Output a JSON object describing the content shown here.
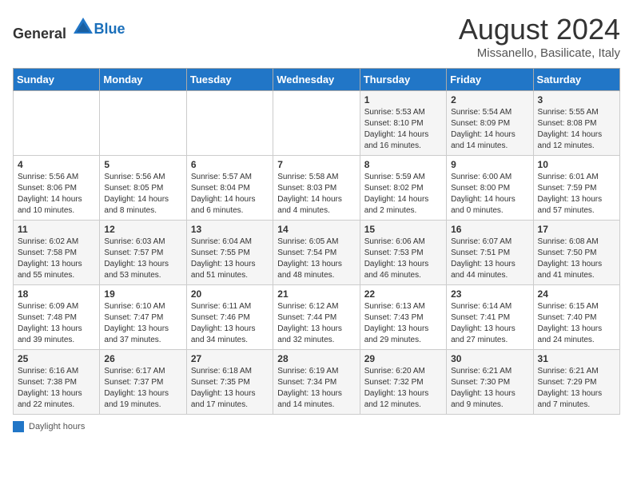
{
  "header": {
    "logo_general": "General",
    "logo_blue": "Blue",
    "title": "August 2024",
    "subtitle": "Missanello, Basilicate, Italy"
  },
  "days_of_week": [
    "Sunday",
    "Monday",
    "Tuesday",
    "Wednesday",
    "Thursday",
    "Friday",
    "Saturday"
  ],
  "weeks": [
    [
      {
        "day": "",
        "info": ""
      },
      {
        "day": "",
        "info": ""
      },
      {
        "day": "",
        "info": ""
      },
      {
        "day": "",
        "info": ""
      },
      {
        "day": "1",
        "info": "Sunrise: 5:53 AM\nSunset: 8:10 PM\nDaylight: 14 hours and 16 minutes."
      },
      {
        "day": "2",
        "info": "Sunrise: 5:54 AM\nSunset: 8:09 PM\nDaylight: 14 hours and 14 minutes."
      },
      {
        "day": "3",
        "info": "Sunrise: 5:55 AM\nSunset: 8:08 PM\nDaylight: 14 hours and 12 minutes."
      }
    ],
    [
      {
        "day": "4",
        "info": "Sunrise: 5:56 AM\nSunset: 8:06 PM\nDaylight: 14 hours and 10 minutes."
      },
      {
        "day": "5",
        "info": "Sunrise: 5:56 AM\nSunset: 8:05 PM\nDaylight: 14 hours and 8 minutes."
      },
      {
        "day": "6",
        "info": "Sunrise: 5:57 AM\nSunset: 8:04 PM\nDaylight: 14 hours and 6 minutes."
      },
      {
        "day": "7",
        "info": "Sunrise: 5:58 AM\nSunset: 8:03 PM\nDaylight: 14 hours and 4 minutes."
      },
      {
        "day": "8",
        "info": "Sunrise: 5:59 AM\nSunset: 8:02 PM\nDaylight: 14 hours and 2 minutes."
      },
      {
        "day": "9",
        "info": "Sunrise: 6:00 AM\nSunset: 8:00 PM\nDaylight: 14 hours and 0 minutes."
      },
      {
        "day": "10",
        "info": "Sunrise: 6:01 AM\nSunset: 7:59 PM\nDaylight: 13 hours and 57 minutes."
      }
    ],
    [
      {
        "day": "11",
        "info": "Sunrise: 6:02 AM\nSunset: 7:58 PM\nDaylight: 13 hours and 55 minutes."
      },
      {
        "day": "12",
        "info": "Sunrise: 6:03 AM\nSunset: 7:57 PM\nDaylight: 13 hours and 53 minutes."
      },
      {
        "day": "13",
        "info": "Sunrise: 6:04 AM\nSunset: 7:55 PM\nDaylight: 13 hours and 51 minutes."
      },
      {
        "day": "14",
        "info": "Sunrise: 6:05 AM\nSunset: 7:54 PM\nDaylight: 13 hours and 48 minutes."
      },
      {
        "day": "15",
        "info": "Sunrise: 6:06 AM\nSunset: 7:53 PM\nDaylight: 13 hours and 46 minutes."
      },
      {
        "day": "16",
        "info": "Sunrise: 6:07 AM\nSunset: 7:51 PM\nDaylight: 13 hours and 44 minutes."
      },
      {
        "day": "17",
        "info": "Sunrise: 6:08 AM\nSunset: 7:50 PM\nDaylight: 13 hours and 41 minutes."
      }
    ],
    [
      {
        "day": "18",
        "info": "Sunrise: 6:09 AM\nSunset: 7:48 PM\nDaylight: 13 hours and 39 minutes."
      },
      {
        "day": "19",
        "info": "Sunrise: 6:10 AM\nSunset: 7:47 PM\nDaylight: 13 hours and 37 minutes."
      },
      {
        "day": "20",
        "info": "Sunrise: 6:11 AM\nSunset: 7:46 PM\nDaylight: 13 hours and 34 minutes."
      },
      {
        "day": "21",
        "info": "Sunrise: 6:12 AM\nSunset: 7:44 PM\nDaylight: 13 hours and 32 minutes."
      },
      {
        "day": "22",
        "info": "Sunrise: 6:13 AM\nSunset: 7:43 PM\nDaylight: 13 hours and 29 minutes."
      },
      {
        "day": "23",
        "info": "Sunrise: 6:14 AM\nSunset: 7:41 PM\nDaylight: 13 hours and 27 minutes."
      },
      {
        "day": "24",
        "info": "Sunrise: 6:15 AM\nSunset: 7:40 PM\nDaylight: 13 hours and 24 minutes."
      }
    ],
    [
      {
        "day": "25",
        "info": "Sunrise: 6:16 AM\nSunset: 7:38 PM\nDaylight: 13 hours and 22 minutes."
      },
      {
        "day": "26",
        "info": "Sunrise: 6:17 AM\nSunset: 7:37 PM\nDaylight: 13 hours and 19 minutes."
      },
      {
        "day": "27",
        "info": "Sunrise: 6:18 AM\nSunset: 7:35 PM\nDaylight: 13 hours and 17 minutes."
      },
      {
        "day": "28",
        "info": "Sunrise: 6:19 AM\nSunset: 7:34 PM\nDaylight: 13 hours and 14 minutes."
      },
      {
        "day": "29",
        "info": "Sunrise: 6:20 AM\nSunset: 7:32 PM\nDaylight: 13 hours and 12 minutes."
      },
      {
        "day": "30",
        "info": "Sunrise: 6:21 AM\nSunset: 7:30 PM\nDaylight: 13 hours and 9 minutes."
      },
      {
        "day": "31",
        "info": "Sunrise: 6:21 AM\nSunset: 7:29 PM\nDaylight: 13 hours and 7 minutes."
      }
    ]
  ],
  "legend": {
    "label": "Daylight hours"
  }
}
